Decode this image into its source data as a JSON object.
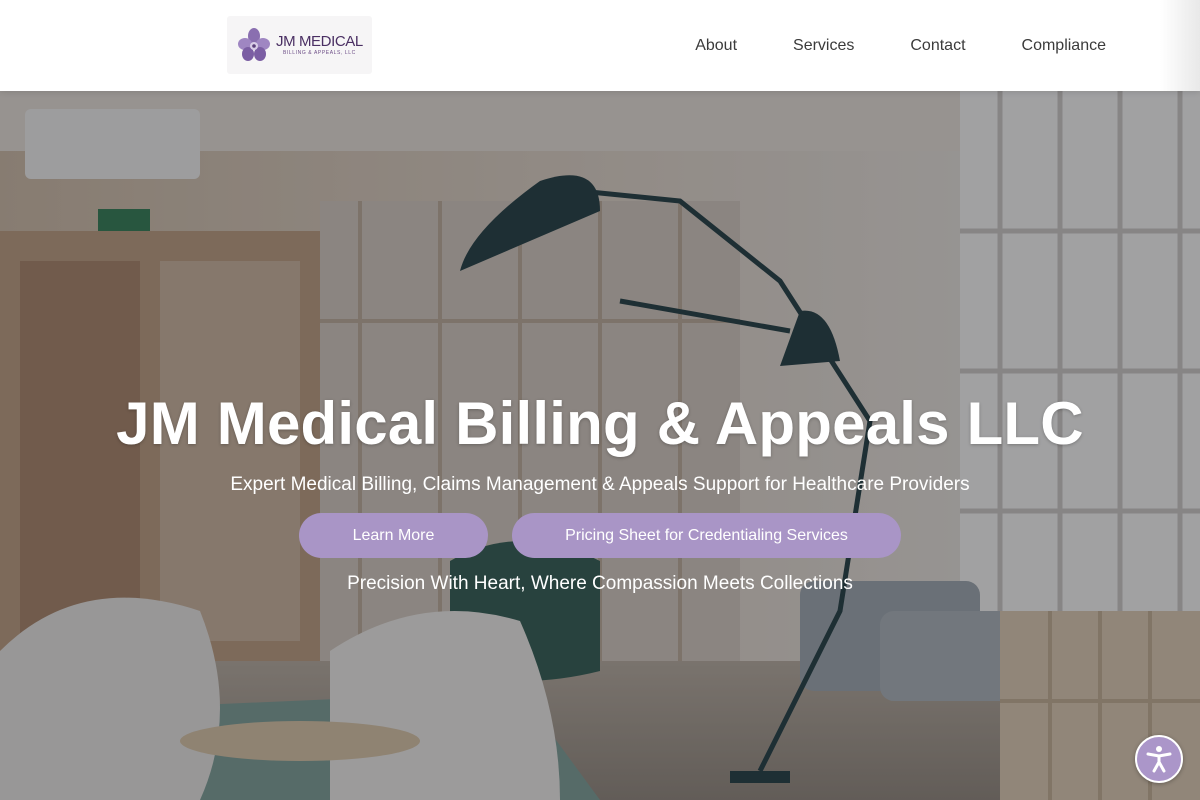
{
  "header": {
    "logo": {
      "main_text": "JM MEDICAL",
      "sub_text": "BILLING & APPEALS, LLC",
      "icon": "orchid-flower-icon"
    },
    "nav": [
      {
        "label": "About"
      },
      {
        "label": "Services"
      },
      {
        "label": "Contact"
      },
      {
        "label": "Compliance"
      }
    ]
  },
  "hero": {
    "title": "JM Medical Billing & Appeals LLC",
    "subtitle": "Expert Medical Billing, Claims Management & Appeals Support for Healthcare Providers",
    "buttons": {
      "learn_more": "Learn More",
      "pricing": "Pricing Sheet for Credentialing Services"
    },
    "tagline": "Precision With Heart, Where Compassion Meets Collections"
  },
  "accessibility": {
    "icon": "accessibility-person-icon"
  },
  "colors": {
    "accent": "#a995c6",
    "logo_purple": "#4a2f63",
    "nav_text": "#3b3b3b",
    "hero_text": "#ffffff"
  }
}
